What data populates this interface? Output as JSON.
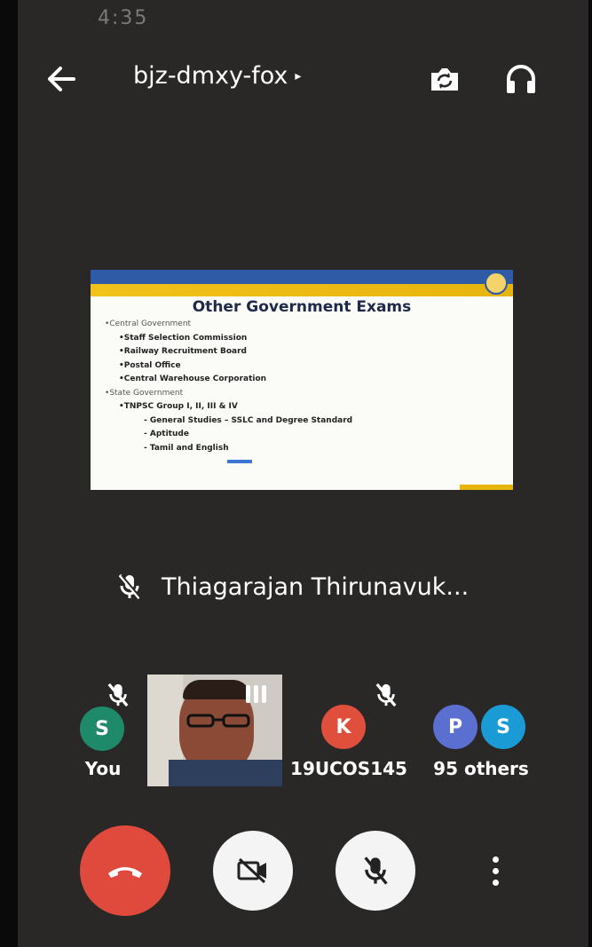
{
  "status_bar": {
    "time": "4:35"
  },
  "header": {
    "meeting_code": "bjz-dmxy-fox",
    "caret": "▸"
  },
  "slide": {
    "title": "Other Government Exams",
    "items": [
      {
        "level": 1,
        "text": "Central Government"
      },
      {
        "level": 2,
        "text": "Staff Selection Commission"
      },
      {
        "level": 2,
        "text": "Railway Recruitment Board"
      },
      {
        "level": 2,
        "text": "Postal Office"
      },
      {
        "level": 2,
        "text": "Central Warehouse Corporation"
      },
      {
        "level": 1,
        "text": "State Government"
      },
      {
        "level": 2,
        "text": "TNPSC Group I, II, III & IV"
      },
      {
        "level": 3,
        "text": "General Studies – SSLC and Degree Standard"
      },
      {
        "level": 3,
        "text": "Aptitude"
      },
      {
        "level": 3,
        "text": "Tamil and English"
      }
    ]
  },
  "presenter": {
    "name": "Thiagarajan Thirunavuk..."
  },
  "participants": {
    "you": {
      "initial": "S",
      "label": "You",
      "color": "#1e8a6a"
    },
    "k": {
      "initial": "K",
      "label": "19UCOS145",
      "color": "#e04f3c"
    },
    "others": {
      "initials": [
        "P",
        "S"
      ],
      "colors": [
        "#5b6fd1",
        "#1a9bd6"
      ],
      "label": "95 others"
    }
  },
  "controls": {
    "hangup": "end-call",
    "camera": "camera-off",
    "mic": "mic-off",
    "more": "more-options"
  }
}
